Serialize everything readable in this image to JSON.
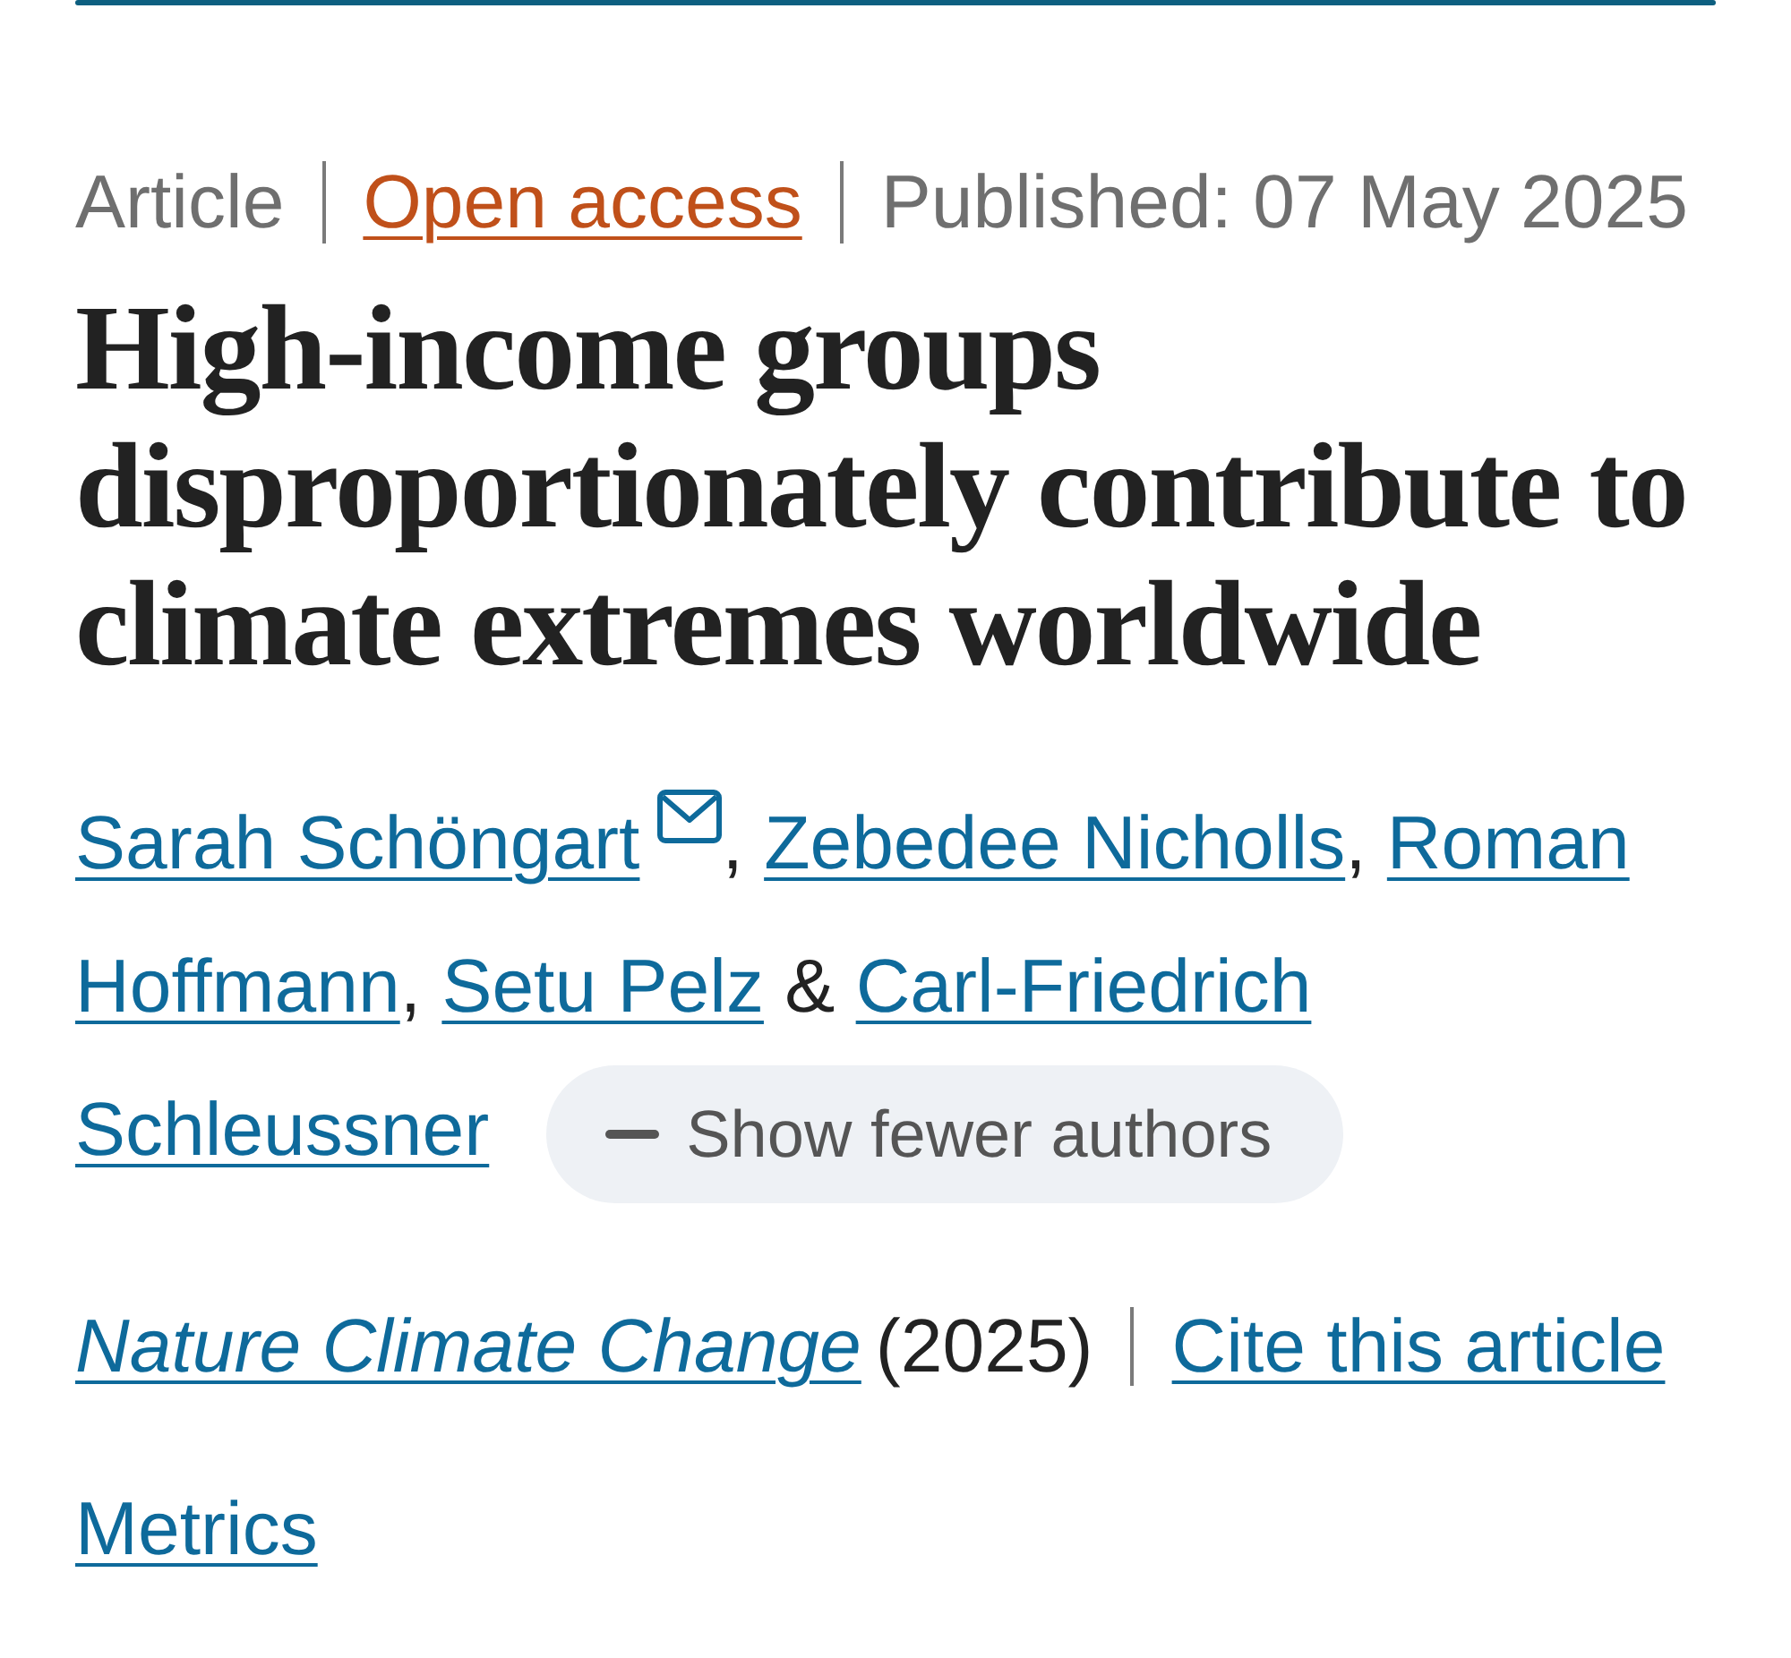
{
  "meta": [
    {
      "kind": "type",
      "text": "Article"
    },
    {
      "kind": "access",
      "text": "Open access"
    },
    {
      "kind": "date",
      "text": "Published: 07 May 2025"
    }
  ],
  "title": "High-income groups disproportionately contribute to climate extremes worldwide",
  "authors": [
    {
      "name": "Sarah Schöngart",
      "email": true,
      "joiner": {
        "kind": "comma",
        "text": ","
      }
    },
    {
      "name": "Zebedee Nicholls",
      "email": false,
      "joiner": {
        "kind": "comma",
        "text": ","
      }
    },
    {
      "name": "Roman Hoffmann",
      "email": false,
      "joiner": {
        "kind": "comma",
        "text": ","
      }
    },
    {
      "name": "Setu Pelz",
      "email": false,
      "joiner": {
        "kind": "and",
        "text": "&"
      }
    },
    {
      "name": "Carl-Friedrich Schleussner",
      "email": false
    }
  ],
  "author_toggle": {
    "label": "Show fewer authors",
    "expanded": true
  },
  "citation": {
    "journal": "Nature Climate Change",
    "year": "(2025)",
    "cite_link": "Cite this article"
  },
  "metrics_link": "Metrics"
}
